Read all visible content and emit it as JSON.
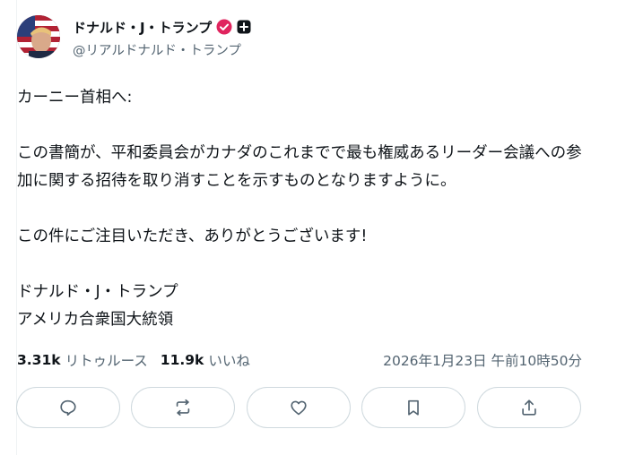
{
  "post": {
    "author_name": "ドナルド・J・トランプ",
    "author_handle": "@リアルドナルド・トランプ",
    "body_lines": [
      "カーニー首相へ:",
      "",
      "この書簡が、平和委員会がカナダのこれまでで最も権威あるリーダー会議への参",
      "加に関する招待を取り消すことを示すものとなりますように。",
      "",
      "この件にご注目いただき、ありがとうございます!",
      "",
      "ドナルド・J・トランプ",
      "アメリカ合衆国大統領"
    ],
    "reposts_count": "3.31k",
    "reposts_label": "リトゥルース",
    "likes_count": "11.9k",
    "likes_label": "いいね",
    "timestamp": "2026年1月23日 午前10時50分"
  },
  "badges": {
    "verified_color": "#e0245e",
    "plus_color": "#0f1419"
  },
  "actions": [
    {
      "icon": "reply-icon"
    },
    {
      "icon": "repost-icon"
    },
    {
      "icon": "like-icon"
    },
    {
      "icon": "bookmark-icon"
    },
    {
      "icon": "share-icon"
    }
  ]
}
